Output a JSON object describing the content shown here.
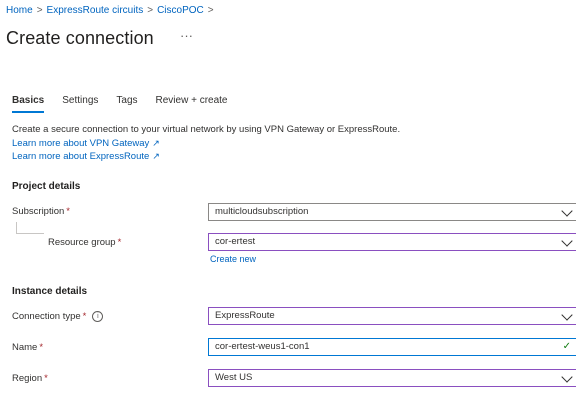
{
  "breadcrumb": {
    "items": [
      "Home",
      "ExpressRoute circuits",
      "CiscoPOC"
    ],
    "separator": ">"
  },
  "page": {
    "title": "Create connection",
    "more_label": "···"
  },
  "tabs": [
    {
      "label": "Basics",
      "active": true
    },
    {
      "label": "Settings",
      "active": false
    },
    {
      "label": "Tags",
      "active": false
    },
    {
      "label": "Review + create",
      "active": false
    }
  ],
  "intro": {
    "description": "Create a secure connection to your virtual network by using VPN Gateway or ExpressRoute.",
    "link_vpn": "Learn more about VPN Gateway",
    "link_er": "Learn more about ExpressRoute",
    "external_icon": "external-link-icon"
  },
  "project_details": {
    "heading": "Project details",
    "subscription_label": "Subscription",
    "subscription_value": "multicloudsubscription",
    "resource_group_label": "Resource group",
    "resource_group_value": "cor-ertest",
    "create_new": "Create new"
  },
  "instance_details": {
    "heading": "Instance details",
    "connection_type_label": "Connection type",
    "connection_type_value": "ExpressRoute",
    "name_label": "Name",
    "name_value": "cor-ertest-weus1-con1",
    "region_label": "Region",
    "region_value": "West US"
  },
  "required_marker": "*",
  "info_glyph": "i",
  "colors": {
    "link": "#0064bf",
    "accent": "#0078d4",
    "required": "#a4262c",
    "field_focus_purple": "#8a4fc0",
    "valid": "#107c10"
  }
}
